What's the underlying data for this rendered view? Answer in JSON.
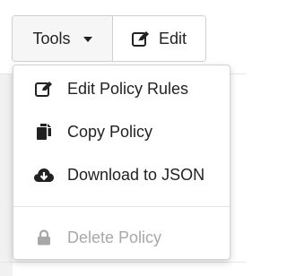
{
  "toolbar": {
    "tools_label": "Tools",
    "edit_label": "Edit"
  },
  "menu": {
    "items": [
      {
        "label": "Edit Policy Rules",
        "icon": "edit-icon",
        "enabled": true
      },
      {
        "label": "Copy Policy",
        "icon": "copy-icon",
        "enabled": true
      },
      {
        "label": "Download to JSON",
        "icon": "cloud-download-icon",
        "enabled": true
      },
      {
        "label": "Delete Policy",
        "icon": "lock-icon",
        "enabled": false
      }
    ]
  },
  "colors": {
    "text": "#222222",
    "disabled_text": "#a8a8a8",
    "border": "#cfcfcf"
  }
}
